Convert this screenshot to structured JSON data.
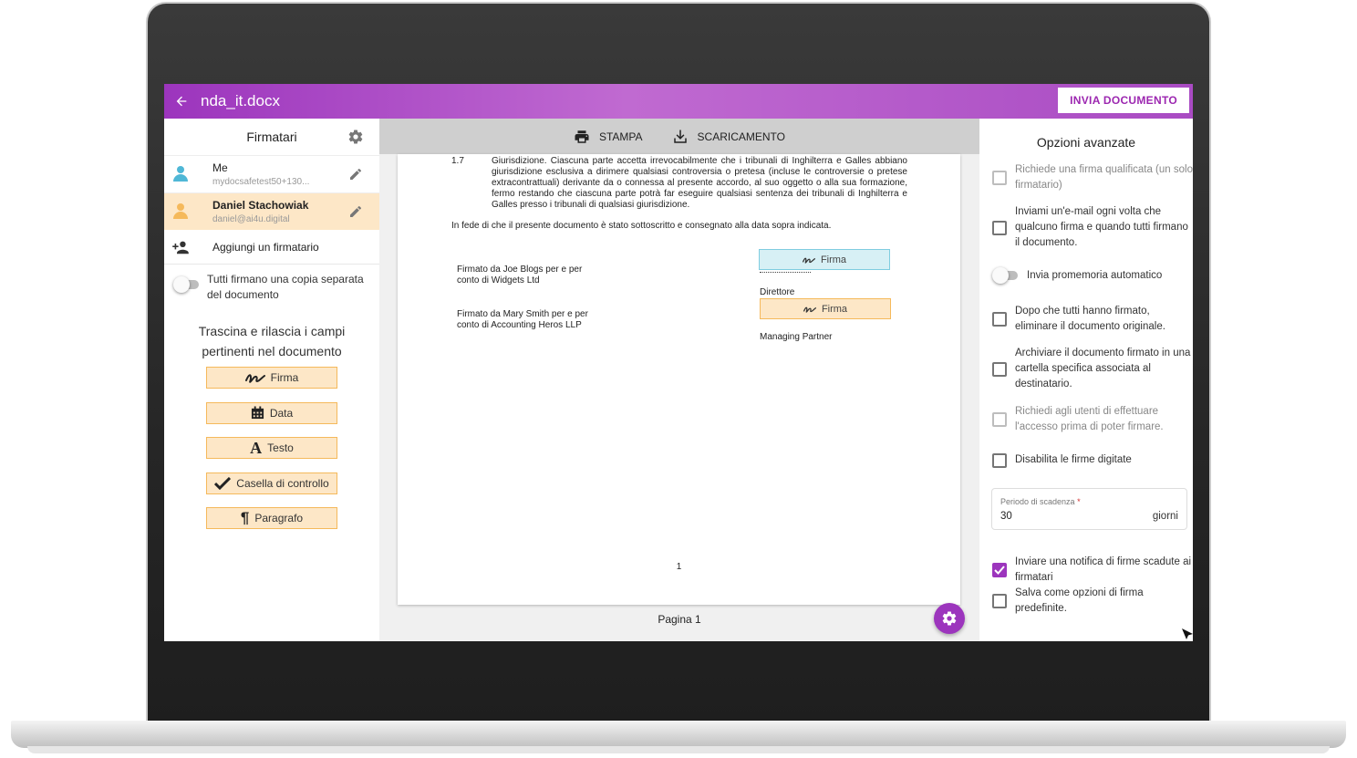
{
  "app": {
    "document_title": "nda_it.docx",
    "send_button": "INVIA DOCUMENTO",
    "accent_color": "#9c35bd"
  },
  "left_panel": {
    "title": "Firmatari",
    "signers": [
      {
        "name": "Me",
        "email": "mydocsafetest50+130...",
        "color": "#4fb7d6",
        "active": false
      },
      {
        "name": "Daniel Stachowiak",
        "email": "daniel@ai4u.digital",
        "color": "#f5b95b",
        "active": true
      }
    ],
    "add_signer": "Aggiungi un firmatario",
    "separate_copy_toggle": {
      "label": "Tutti firmano una copia separata del documento",
      "on": false
    },
    "drag_hint": "Trascina e rilascia i campi pertinenti nel documento",
    "fields": [
      {
        "label": "Firma",
        "icon": "signature-icon"
      },
      {
        "label": "Data",
        "icon": "calendar-icon"
      },
      {
        "label": "Testo",
        "icon": "text-icon"
      },
      {
        "label": "Casella di controllo",
        "icon": "checkmark-icon"
      },
      {
        "label": "Paragrafo",
        "icon": "paragraph-icon"
      }
    ]
  },
  "toolbar": {
    "print": "STAMPA",
    "download": "SCARICAMENTO"
  },
  "document": {
    "clause_number": "1.7",
    "clause_text": "Giurisdizione. Ciascuna parte accetta irrevocabilmente che i tribunali di Inghilterra e Galles abbiano giurisdizione esclusiva a dirimere qualsiasi controversia o pretesa (incluse le controversie o pretese extracontrattuali) derivante da o connessa al presente accordo, al suo oggetto o alla sua formazione, fermo restando che ciascuna parte potrà far eseguire qualsiasi sentenza dei tribunali di Inghilterra e Galles presso i tribunali di qualsiasi giurisdizione.",
    "witness": "In fede di che il presente documento è stato sottoscritto e consegnato alla data sopra indicata.",
    "signed_by_1": "Firmato da Joe Blogs per e per conto di Widgets Ltd",
    "signed_by_2": "Firmato da Mary Smith per e per conto di Accounting Heros LLP",
    "sig_field_1": "Firma",
    "sig_field_2": "Firma",
    "role_1": "Direttore",
    "role_2": "Managing Partner",
    "page_number": "1",
    "page_label": "Pagina 1"
  },
  "right_panel": {
    "title": "Opzioni avanzate",
    "options": [
      {
        "label": "Richiede una firma qualificata (un solo firmatario)",
        "checked": false,
        "disabled": true
      },
      {
        "label": "Inviami un'e-mail ogni volta che qualcuno firma e quando tutti firmano il documento.",
        "checked": false,
        "disabled": false
      },
      {
        "label": "Invia promemoria automatico",
        "toggle": true,
        "on": false
      },
      {
        "label": "Dopo che tutti hanno firmato, eliminare il documento originale.",
        "checked": false,
        "disabled": false
      },
      {
        "label": "Archiviare il documento firmato in una cartella specifica associata al destinatario.",
        "checked": false,
        "disabled": false
      },
      {
        "label": "Richiedi agli utenti di effettuare l'accesso prima di poter firmare.",
        "checked": false,
        "disabled": true
      },
      {
        "label": "Disabilita le firme digitate",
        "checked": false,
        "disabled": false
      }
    ],
    "expiry": {
      "caption": "Periodo di scadenza",
      "required_mark": "*",
      "value": "30",
      "unit": "giorni"
    },
    "notify_expired": {
      "label": "Inviare una notifica di firme scadute ai firmatari",
      "checked": true
    },
    "save_default": {
      "label": "Salva come opzioni di firma predefinite.",
      "checked": false
    }
  }
}
